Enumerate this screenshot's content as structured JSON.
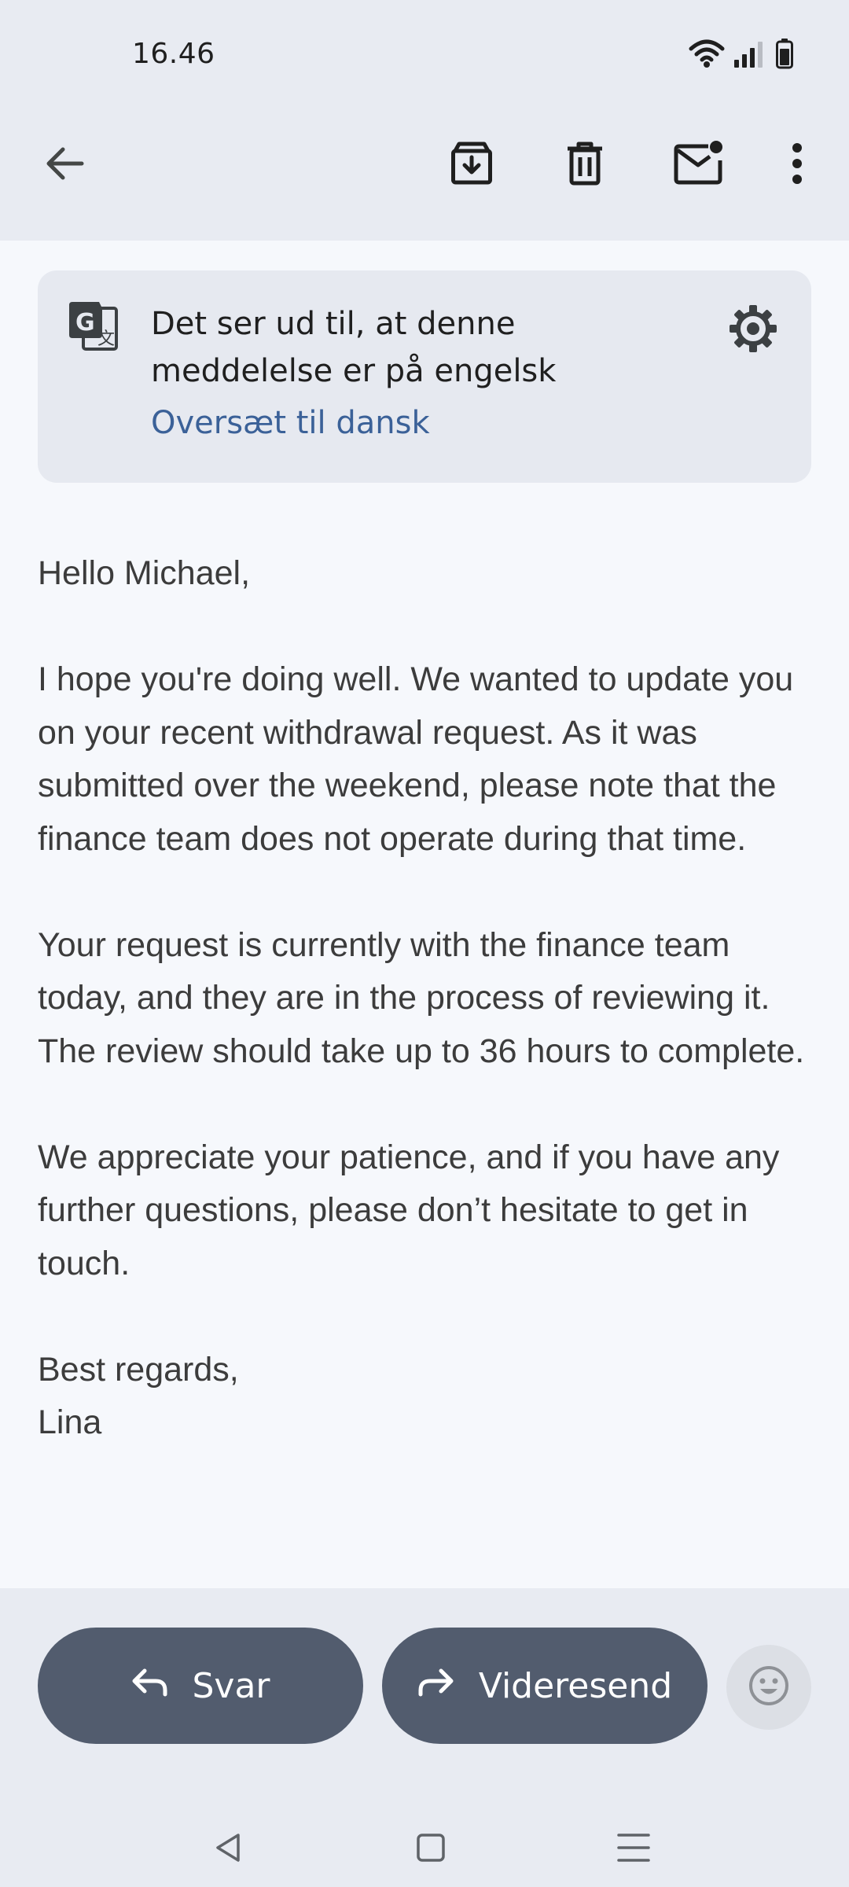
{
  "status_bar": {
    "time": "16.46",
    "icons": [
      "wifi-icon",
      "signal-icon",
      "battery-icon"
    ]
  },
  "toolbar": {
    "icons": [
      "back-arrow-icon",
      "archive-icon",
      "delete-icon",
      "mark-unread-icon",
      "more-vert-icon"
    ]
  },
  "translate_banner": {
    "message": "Det ser ud til, at denne meddelelse er på engelsk",
    "link": "Oversæt til dansk",
    "icons": [
      "google-translate-icon",
      "gear-icon"
    ]
  },
  "email": {
    "greeting": "Hello Michael,",
    "paragraphs": [
      "I hope you're doing well. We wanted to update you on your recent withdrawal request. As it was submitted over the weekend, please note that the finance team does not operate during that time.",
      "Your request is currently with the finance team today, and they are in the process of reviewing it. The review should take up to 36 hours to complete.",
      "We appreciate your patience, and if you have any further questions, please don’t hesitate to get in touch."
    ],
    "closing": "Best regards,",
    "signature": "Lina"
  },
  "actions": {
    "reply_label": "Svar",
    "forward_label": "Videresend",
    "icons": [
      "reply-icon",
      "forward-icon",
      "emoji-icon"
    ]
  },
  "navigation": {
    "icons": [
      "nav-back-icon",
      "nav-home-icon",
      "nav-recents-icon"
    ]
  },
  "colors": {
    "top_bar": "#e8ebf2",
    "background": "#f6f8fc",
    "card": "#e6e9f0",
    "link": "#3b6198",
    "button": "#525c6e"
  }
}
